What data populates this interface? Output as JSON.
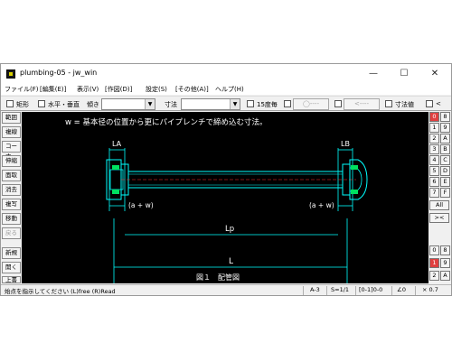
{
  "window": {
    "title": "plumbing-05 - jw_win",
    "minimize": "—",
    "maximize": "☐",
    "close": "✕"
  },
  "menu": [
    "ファイル(F)",
    "[編集(E)]",
    "表示(V)",
    "[作図(D)]",
    "設定(S)",
    "[その他(A)]",
    "ヘルプ(H)"
  ],
  "toolbar": {
    "rect_label": "矩形",
    "hv_label": "水平・垂直",
    "tilt_label": "傾き",
    "dim_label": "寸法",
    "deg15_label": "15度毎",
    "btn_circle": "◯----",
    "btn_arrow": "<----",
    "dimval_label": "寸法値",
    "lt_label": "<"
  },
  "left_tools": [
    "範囲",
    "複線",
    "コーナー",
    "伸縮",
    "面取",
    "消去",
    "複写",
    "移動",
    "戻る",
    "新規",
    "開く",
    "上書"
  ],
  "right_tools": {
    "left_col": [
      "0",
      "1",
      "2",
      "3",
      "4",
      "5",
      "6",
      "7"
    ],
    "right_col": [
      "8",
      "9",
      "A",
      "B",
      "C",
      "D",
      "E",
      "F"
    ],
    "all": "All",
    "xchg": "><",
    "layer_a": [
      "0",
      "8"
    ],
    "layer_b": [
      "1",
      "9"
    ],
    "layer_c": [
      "2",
      "A"
    ]
  },
  "drawing": {
    "note": "w = 基本径の位置から更にパイプレンチで締め込む寸法。",
    "label_la": "LA",
    "label_lb": "LB",
    "label_aw_left": "(a + w)",
    "label_aw_right": "(a + w)",
    "label_lp": "Lp",
    "label_l": "L",
    "caption": "図１　配管図"
  },
  "status": {
    "message": "始点を指示してください (L)free (R)Read",
    "scale_a": "A-3",
    "scale_s": "S=1/1",
    "layer": "[0-1]0-0",
    "angle": "∠0",
    "zoom": "× 0.7"
  }
}
